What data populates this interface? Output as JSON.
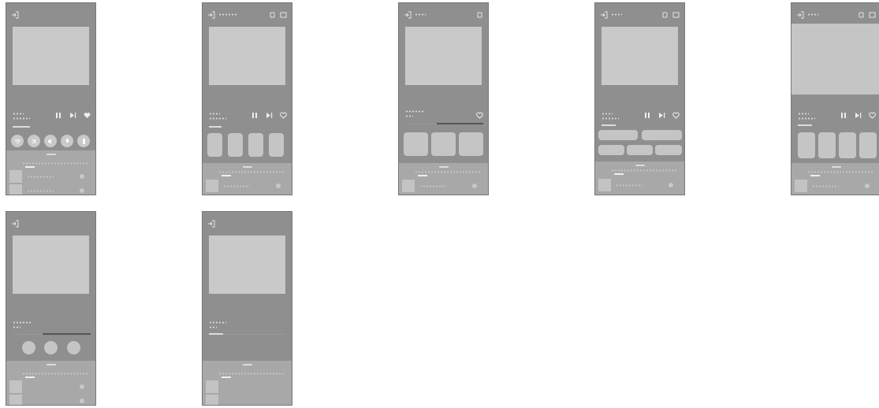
{
  "screens": [
    {
      "id": "screen-1",
      "title_shown": false,
      "panel_rows": 2
    },
    {
      "id": "screen-2",
      "title_shown": true,
      "panel_rows": 1
    },
    {
      "id": "screen-3",
      "title_shown": true,
      "panel_rows": 1
    },
    {
      "id": "screen-4",
      "title_shown": true,
      "panel_rows": 1
    },
    {
      "id": "screen-5",
      "title_shown": true,
      "panel_rows": 1
    },
    {
      "id": "screen-6",
      "title_shown": false,
      "panel_rows": 2
    },
    {
      "id": "screen-7",
      "title_shown": false,
      "panel_rows": 2
    }
  ],
  "icons": {
    "exit": "exit-icon",
    "hand": "hand-icon",
    "cast": "cast-icon",
    "pause": "pause-icon",
    "next": "next-icon",
    "like": "heart-icon"
  },
  "colors": {
    "screen_bg": "#8f8f8f",
    "artwork": "#c9c9c9",
    "panel": "#a8a8a8",
    "control": "#c5c5c5",
    "text_placeholder": "#dcdcdc"
  }
}
